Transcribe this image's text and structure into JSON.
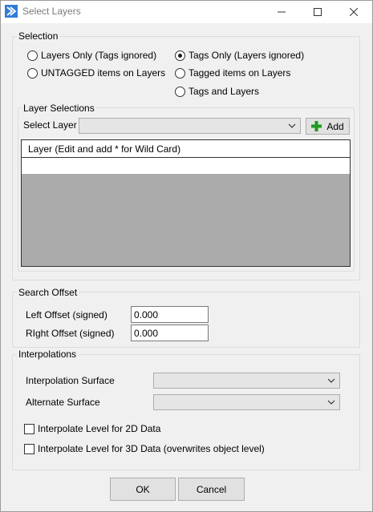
{
  "window": {
    "title": "Select Layers"
  },
  "selection": {
    "legend": "Selection",
    "options": [
      {
        "label": "Layers Only (Tags ignored)",
        "selected": false
      },
      {
        "label": "UNTAGGED items on Layers",
        "selected": false
      },
      {
        "label": "Tags Only (Layers ignored)",
        "selected": true
      },
      {
        "label": "Tagged items on Layers",
        "selected": false
      },
      {
        "label": "Tags and Layers",
        "selected": false
      }
    ]
  },
  "layer_selections": {
    "legend": "Layer Selections",
    "select_layer_label": "Select Layer",
    "select_layer_value": "",
    "add_button": "Add",
    "grid_header": "Layer (Edit and add * for Wild Card)"
  },
  "search_offset": {
    "legend": "Search Offset",
    "left_label": "Left Offset (signed)",
    "left_value": "0.000",
    "right_label": "RIght Offset (signed)",
    "right_value": "0.000"
  },
  "interpolations": {
    "legend": "Interpolations",
    "surface_label": "Interpolation Surface",
    "surface_value": "",
    "alternate_label": "Alternate Surface",
    "alternate_value": "",
    "check_2d": "Interpolate Level for 2D Data",
    "check_3d": "Interpolate Level for 3D Data (overwrites object level)"
  },
  "footer": {
    "ok": "OK",
    "cancel": "Cancel"
  }
}
